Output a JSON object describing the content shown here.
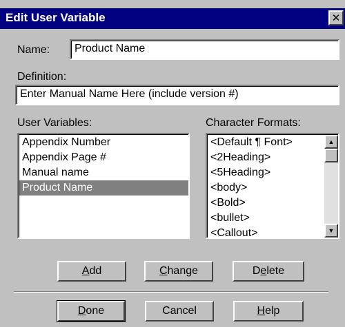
{
  "dialog": {
    "title": "Edit User Variable",
    "close_glyph": "✕"
  },
  "name": {
    "label": "Name:",
    "value": "Product Name"
  },
  "definition": {
    "label": "Definition:",
    "value": "Enter Manual Name Here (include version #)"
  },
  "user_variables": {
    "label": "User Variables:",
    "items": [
      "Appendix Number",
      "Appendix Page #",
      "Manual name",
      "Product Name"
    ],
    "selected": "Product Name"
  },
  "character_formats": {
    "label": "Character Formats:",
    "items": [
      "<Default ¶ Font>",
      "<2Heading>",
      "<5Heading>",
      "<body>",
      "<Bold>",
      "<bullet>",
      "<Callout>"
    ]
  },
  "buttons": {
    "add": {
      "mnemonic": "A",
      "rest": "dd"
    },
    "change": {
      "mnemonic": "C",
      "rest": "hange"
    },
    "delete": {
      "pre": "D",
      "mnemonic": "e",
      "rest": "lete"
    },
    "done": {
      "mnemonic": "D",
      "rest": "one"
    },
    "cancel": {
      "label": "Cancel"
    },
    "help": {
      "mnemonic": "H",
      "rest": "elp"
    }
  },
  "icons": {
    "scroll_up": "▲",
    "scroll_down": "▼"
  }
}
